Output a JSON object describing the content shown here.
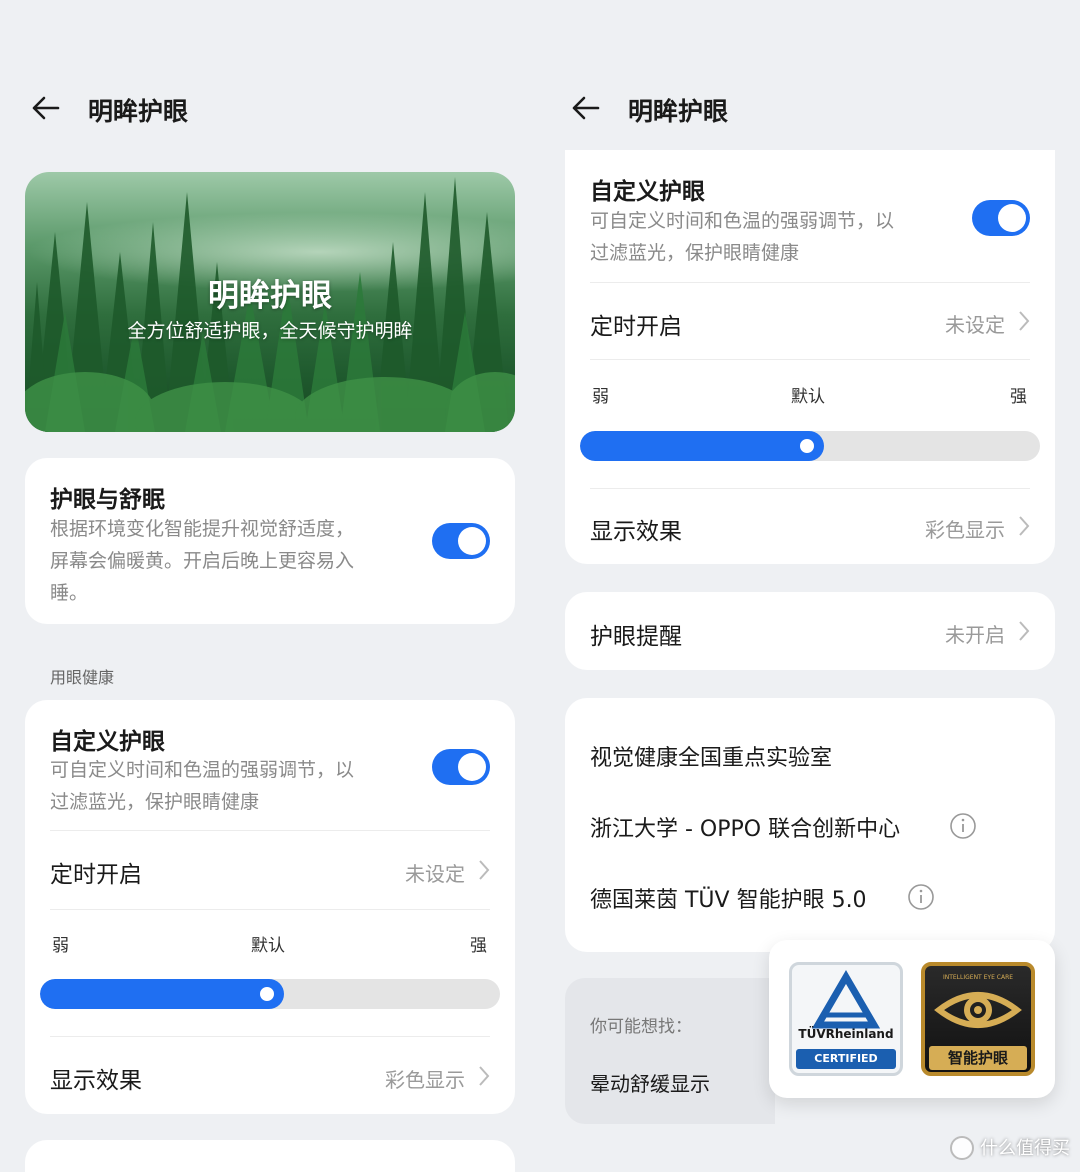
{
  "left": {
    "header": {
      "title": "明眸护眼"
    },
    "banner": {
      "title": "明眸护眼",
      "subtitle": "全方位舒适护眼，全天候守护明眸"
    },
    "eye_sleep": {
      "title": "护眼与舒眠",
      "desc1": "根据环境变化智能提升视觉舒适度，",
      "desc2": "屏幕会偏暖黄。开启后晚上更容易入",
      "desc3": "睡。",
      "enabled": true
    },
    "section_label": "用眼健康",
    "custom": {
      "title": "自定义护眼",
      "desc1": "可自定义时间和色温的强弱调节，以",
      "desc2": "过滤蓝光，保护眼睛健康",
      "enabled": true,
      "schedule_label": "定时开启",
      "schedule_value": "未设定",
      "level_weak": "弱",
      "level_default": "默认",
      "level_strong": "强",
      "level_value": 0.53,
      "display_label": "显示效果",
      "display_value": "彩色显示"
    }
  },
  "right": {
    "header": {
      "title": "明眸护眼"
    },
    "custom": {
      "title": "自定义护眼",
      "desc1": "可自定义时间和色温的强弱调节，以",
      "desc2": "过滤蓝光，保护眼睛健康",
      "enabled": true,
      "schedule_label": "定时开启",
      "schedule_value": "未设定",
      "level_weak": "弱",
      "level_default": "默认",
      "level_strong": "强",
      "level_value": 0.53,
      "display_label": "显示效果",
      "display_value": "彩色显示"
    },
    "reminder": {
      "label": "护眼提醒",
      "value": "未开启"
    },
    "labs": {
      "row1": "视觉健康全国重点实验室",
      "row2": "浙江大学 - OPPO 联合创新中心",
      "row3": "德国莱茵 TÜV 智能护眼 5.0"
    },
    "suggest": {
      "label": "你可能想找：",
      "item": "晕动舒缓显示"
    },
    "badges": {
      "tuv_name": "TÜVRheinland",
      "tuv_cert": "CERTIFIED",
      "eye_top": "INTELLIGENT EYE CARE",
      "eye_label": "智能护眼"
    }
  },
  "watermark": "什么值得买",
  "colors": {
    "accent": "#1f6ff2",
    "background": "#eef0f3"
  }
}
